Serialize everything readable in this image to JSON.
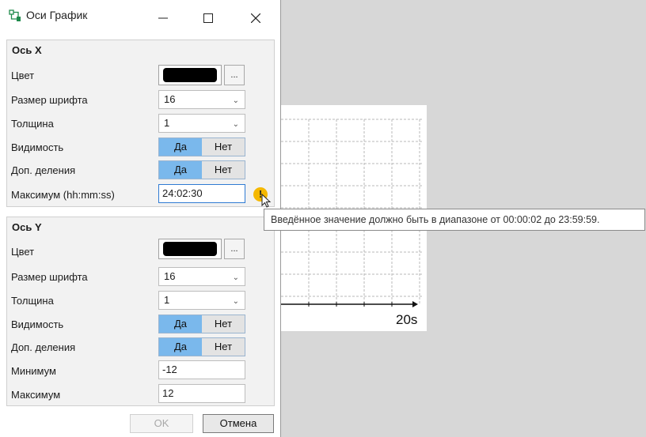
{
  "window": {
    "title": "Оси График"
  },
  "axis_x": {
    "title": "Ось X",
    "color_label": "Цвет",
    "color_value": "#000000",
    "color_button": "...",
    "font_size_label": "Размер шрифта",
    "font_size_value": "16",
    "thickness_label": "Толщина",
    "thickness_value": "1",
    "visibility_label": "Видимость",
    "visibility_yes": "Да",
    "visibility_no": "Нет",
    "extra_ticks_label": "Доп. деления",
    "extra_ticks_yes": "Да",
    "extra_ticks_no": "Нет",
    "max_label": "Максимум (hh:mm:ss)",
    "max_value": "24:02:30"
  },
  "validation": {
    "icon": "!",
    "message": "Введённое значение должно быть в диапазоне от 00:00:02 до 23:59:59."
  },
  "axis_y": {
    "title": "Ось Y",
    "color_label": "Цвет",
    "color_value": "#000000",
    "color_button": "...",
    "font_size_label": "Размер шрифта",
    "font_size_value": "16",
    "thickness_label": "Толщина",
    "thickness_value": "1",
    "visibility_label": "Видимость",
    "visibility_yes": "Да",
    "visibility_no": "Нет",
    "extra_ticks_label": "Доп. деления",
    "extra_ticks_yes": "Да",
    "extra_ticks_no": "Нет",
    "min_label": "Минимум",
    "min_value": "-12",
    "max_label": "Максимум",
    "max_value": "12"
  },
  "buttons": {
    "ok": "OK",
    "cancel": "Отмена"
  },
  "preview": {
    "x_tick_label": "20s"
  },
  "colors": {
    "toggle_on": "#7ab8ec",
    "warning": "#f5b800"
  }
}
